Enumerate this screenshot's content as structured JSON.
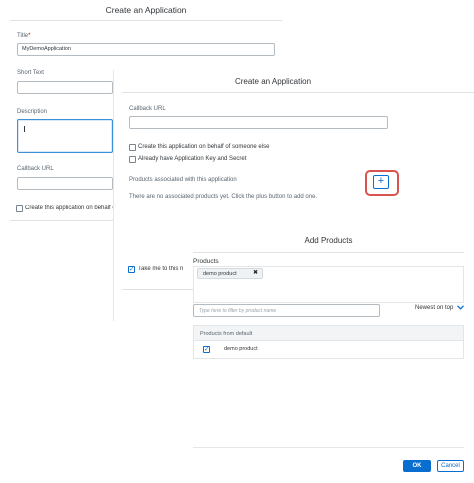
{
  "dialog1": {
    "title": "Create an Application",
    "title_label": "Title",
    "title_required": "*",
    "title_value": "MyDemoApplication",
    "short_text_label": "Short Text",
    "description_label": "Description",
    "callback_label": "Callback URL",
    "behalf_label": "Create this application on behalf o",
    "take_me_label": "Take me to this n"
  },
  "dialog2": {
    "title": "Create an Application",
    "callback_label": "Callback URL",
    "behalf_label": "Create this application on behalf of someone else",
    "have_key_label": "Already have Application Key and Secret",
    "products_label": "Products associated with this application",
    "plus_label": "+",
    "no_products_text": "There are no associated products yet. Click the plus button to add one."
  },
  "dialog3": {
    "title": "Add Products",
    "products_label": "Products",
    "token_label": "demo product",
    "token_remove": "✖",
    "search_placeholder": "Type here to filter by product name",
    "sort_label": "Newest on top",
    "table_header": "Products from default",
    "row_label": "demo product",
    "ok_label": "OK",
    "cancel_label": "Cancel"
  }
}
